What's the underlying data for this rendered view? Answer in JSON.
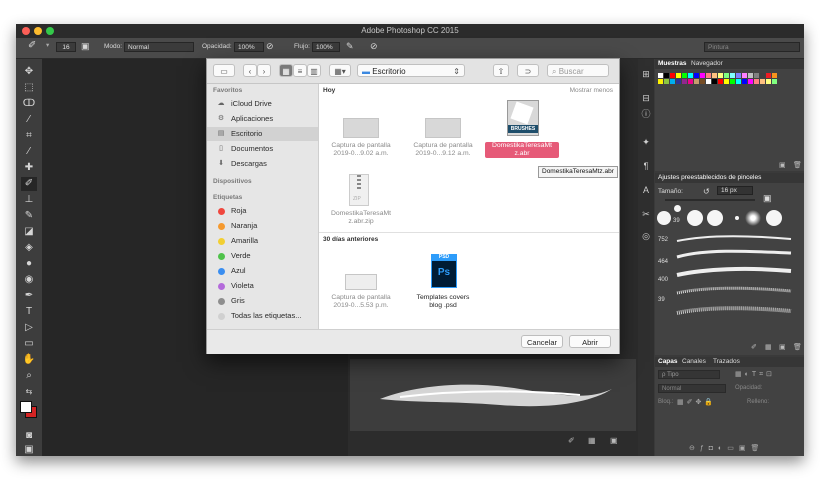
{
  "window": {
    "title": "Adobe Photoshop CC 2015"
  },
  "options_bar": {
    "brush_size": "16",
    "mode_label": "Modo:",
    "mode_value": "Normal",
    "opacity_label": "Opacidad:",
    "opacity_value": "100%",
    "flow_label": "Flujo:",
    "flow_value": "100%",
    "workspace": "Pintura"
  },
  "dialog": {
    "location": "Escritorio",
    "search_placeholder": "Buscar",
    "sidebar": {
      "favorites_header": "Favoritos",
      "favorites": [
        {
          "label": "iCloud Drive",
          "icon": "☁"
        },
        {
          "label": "Aplicaciones",
          "icon": "⚙"
        },
        {
          "label": "Escritorio",
          "icon": "▤"
        },
        {
          "label": "Documentos",
          "icon": "▯"
        },
        {
          "label": "Descargas",
          "icon": "⬇"
        }
      ],
      "devices_header": "Dispositivos",
      "tags_header": "Etiquetas",
      "tags": [
        {
          "label": "Roja",
          "color": "#f0473e"
        },
        {
          "label": "Naranja",
          "color": "#f59a2f"
        },
        {
          "label": "Amarilla",
          "color": "#f2cf32"
        },
        {
          "label": "Verde",
          "color": "#4fc24a"
        },
        {
          "label": "Azul",
          "color": "#3a8ef0"
        },
        {
          "label": "Violeta",
          "color": "#b46bdb"
        },
        {
          "label": "Gris",
          "color": "#8e8e8e"
        },
        {
          "label": "Todas las etiquetas...",
          "color": "#d0d0d0"
        }
      ]
    },
    "section_today": "Hoy",
    "show_less": "Mostrar menos",
    "section_30days": "30 días anteriores",
    "files": {
      "capture1": [
        "Captura de pantalla",
        "2019-0...9.02 a.m."
      ],
      "capture2": [
        "Captura de pantalla",
        "2019-0...9.12 a.m."
      ],
      "brushes_selected": [
        "DomestikaTeresaMt",
        "z.abr"
      ],
      "brushes_badge": "BRUSHES",
      "tooltip": "DomestikaTeresaMtz.abr",
      "zip": [
        "DomestikaTeresaMt",
        "z.abr.zip"
      ],
      "zip_badge": "ZIP",
      "capture3": [
        "Captura de pantalla",
        "2019-0...5.53 p.m."
      ],
      "psd": [
        "Templates covers",
        "blog .psd"
      ],
      "psd_badge": "PSD",
      "ps_letters": "Ps"
    },
    "cancel": "Cancelar",
    "open": "Abrir"
  },
  "panels": {
    "swatches_tab": "Muestras",
    "navigator_tab": "Navegador",
    "brush_presets_title": "Ajustes preestablecidos de pinceles",
    "size_label": "Tamaño:",
    "size_value": "16 px",
    "brush_sizes": [
      "39",
      "752",
      "464",
      "400",
      "39"
    ],
    "layers_tab": "Capas",
    "channels_tab": "Canales",
    "paths_tab": "Trazados",
    "kind_label": "ρ Tipo",
    "blend_mode": "Normal",
    "opacity_label": "Opacidad:",
    "lock_label": "Bloq.:",
    "fill_label": "Relleno:"
  },
  "colors": {
    "selection_blue": "#2d6fe0",
    "selected_file_bg": "#e65a78",
    "foreground": "#ffffff",
    "background": "#d42424"
  }
}
